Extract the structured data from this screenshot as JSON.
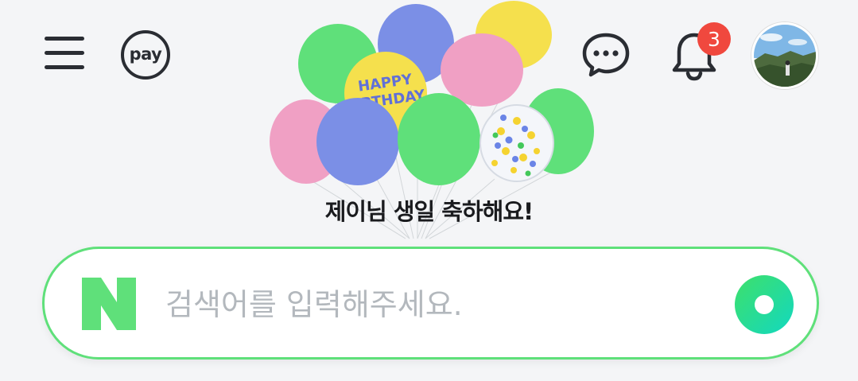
{
  "header": {
    "menu_icon": "hamburger-menu-icon",
    "pay_label": "pay",
    "chat_icon": "chat-bubble-icon",
    "bell_icon": "bell-icon",
    "notification_count": "3",
    "avatar_icon": "profile-photo"
  },
  "doodle": {
    "balloon_text": "HAPPY BIRTHDAY",
    "greeting": "제이님 생일 축하해요!"
  },
  "search": {
    "placeholder": "검색어를 입력해주세요.",
    "value": "",
    "logo_letter": "N"
  },
  "colors": {
    "accent_green": "#5fe07a",
    "badge_red": "#f0483e",
    "icon_dark": "#2a2d33"
  }
}
